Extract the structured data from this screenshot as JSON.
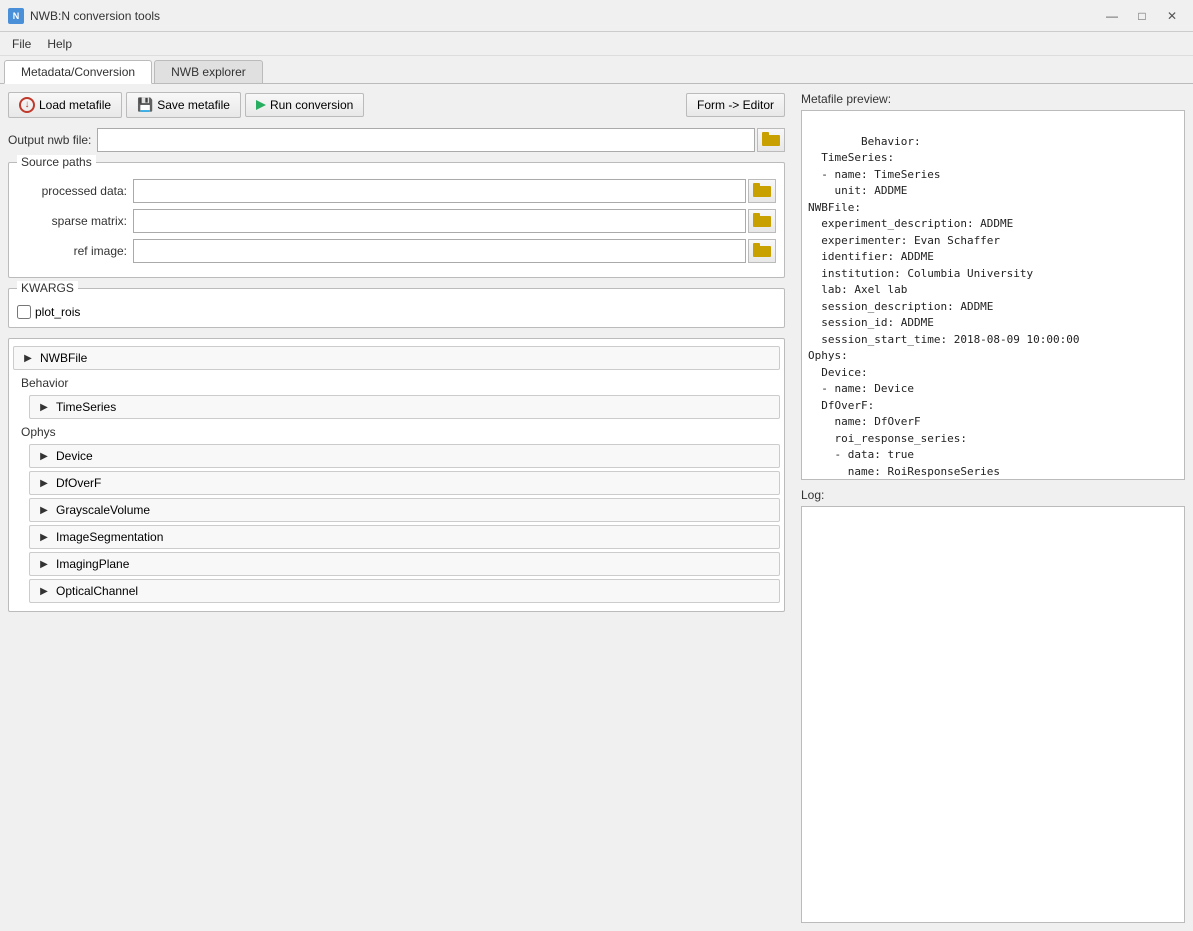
{
  "window": {
    "title": "NWB:N conversion tools",
    "icon": "N"
  },
  "menu": {
    "items": [
      "File",
      "Help"
    ]
  },
  "tabs": [
    {
      "id": "metadata",
      "label": "Metadata/Conversion",
      "active": true
    },
    {
      "id": "nwb-explorer",
      "label": "NWB explorer",
      "active": false
    }
  ],
  "toolbar": {
    "load_label": "Load metafile",
    "save_label": "Save metafile",
    "run_label": "Run conversion",
    "form_editor_label": "Form -> Editor"
  },
  "output_nwb": {
    "label": "Output nwb file:",
    "value": "",
    "placeholder": ""
  },
  "source_paths": {
    "group_label": "Source paths",
    "fields": [
      {
        "label": "processed data:",
        "value": ""
      },
      {
        "label": "sparse matrix:",
        "value": ""
      },
      {
        "label": "ref image:",
        "value": ""
      }
    ]
  },
  "kwargs": {
    "group_label": "KWARGS",
    "items": [
      {
        "label": "plot_rois",
        "checked": false
      }
    ]
  },
  "tree": {
    "sections": [
      {
        "label": "NWBFile",
        "expanded": false,
        "children": []
      },
      {
        "label": "Behavior",
        "children": [
          {
            "label": "TimeSeries",
            "expanded": false
          }
        ]
      },
      {
        "label": "Ophys",
        "children": [
          {
            "label": "Device",
            "expanded": false
          },
          {
            "label": "DfOverF",
            "expanded": false
          },
          {
            "label": "GrayscaleVolume",
            "expanded": false
          },
          {
            "label": "ImageSegmentation",
            "expanded": false
          },
          {
            "label": "ImagingPlane",
            "expanded": false
          },
          {
            "label": "OpticalChannel",
            "expanded": false
          }
        ]
      }
    ]
  },
  "metafile_preview": {
    "label": "Metafile preview:",
    "content": "Behavior:\n  TimeSeries:\n  - name: TimeSeries\n    unit: ADDME\nNWBFile:\n  experiment_description: ADDME\n  experimenter: Evan Schaffer\n  identifier: ADDME\n  institution: Columbia University\n  lab: Axel lab\n  session_description: ADDME\n  session_id: ADDME\n  session_start_time: 2018-08-09 10:00:00\nOphys:\n  Device:\n  - name: Device\n  DfOverF:\n    name: DfOverF\n    roi_response_series:\n    - data: true\n      name: RoiResponseSeries\n      rois: true\n      unit: ADDME"
  },
  "log": {
    "label": "Log:",
    "content": ""
  }
}
